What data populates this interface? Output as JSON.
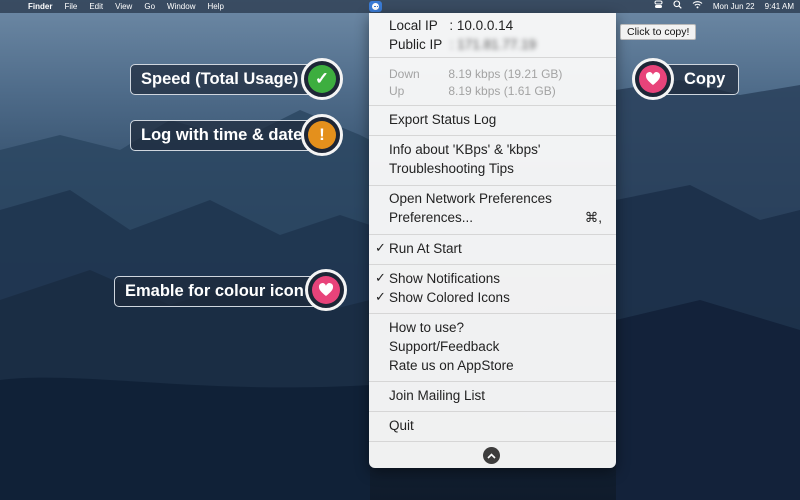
{
  "colors": {
    "accent": "#3a7bd5",
    "check_green": "#3dae3f",
    "warn_orange": "#e4901c",
    "heart_pink": "#e8437a"
  },
  "menubar": {
    "apple_icon": "apple-icon",
    "app_name": "Finder",
    "items": [
      "File",
      "Edit",
      "View",
      "Go",
      "Window",
      "Help"
    ],
    "status_icons": [
      "network-monitor-icon",
      "control-center-icon",
      "search-icon",
      "wifi-icon"
    ],
    "date": "Mon Jun 22",
    "time": "9:41 AM"
  },
  "tooltip": "Click to copy!",
  "menu": {
    "local_ip_label": "Local IP",
    "local_ip_value": ": 10.0.0.14",
    "public_ip_label": "Public IP",
    "public_ip_value": ": 171.81.77.19",
    "down_label": "Down",
    "down_value": "8.19 kbps (19.21 GB)",
    "up_label": "Up",
    "up_value": "8.19 kbps (1.61 GB)",
    "export_log": "Export Status Log",
    "info_kbps": "Info about 'KBps' & 'kbps'",
    "troubleshooting": "Troubleshooting Tips",
    "open_network_prefs": "Open Network Preferences",
    "preferences": "Preferences...",
    "preferences_shortcut": "⌘,",
    "run_at_start": "Run At Start",
    "show_notifications": "Show Notifications",
    "show_colored_icons": "Show Colored Icons",
    "how_to_use": "How to use?",
    "support_feedback": "Support/Feedback",
    "rate_us": "Rate us on AppStore",
    "join_mailing": "Join Mailing List",
    "quit": "Quit",
    "checkmark": "✓",
    "scroll_down": "⌃"
  },
  "callouts": {
    "speed": "Speed (Total Usage)",
    "log": "Log with time & date",
    "colour": "Emable for colour icon",
    "copy": "Copy"
  },
  "badges": {
    "check": "✓",
    "exclaim": "!"
  }
}
